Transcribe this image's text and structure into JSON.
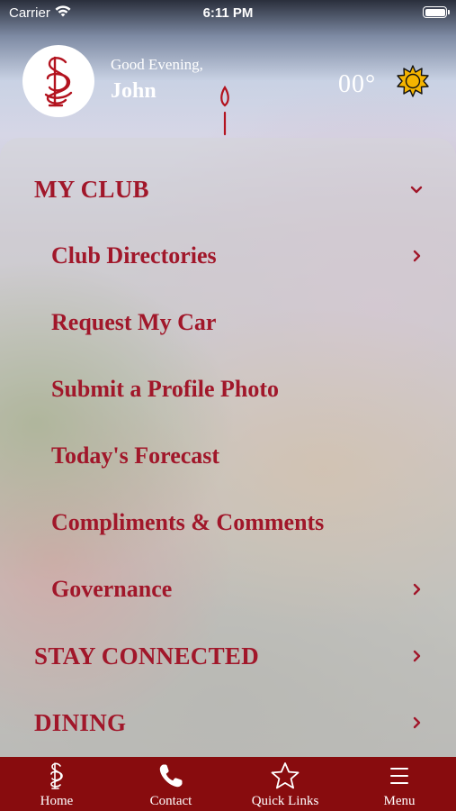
{
  "status_bar": {
    "carrier": "Carrier",
    "time": "6:11 PM"
  },
  "header": {
    "greeting": "Good Evening,",
    "user_name": "John",
    "temperature": "00°",
    "weather_icon": "sun-icon",
    "logo_icon": "club-monogram-logo"
  },
  "menu": {
    "my_club": {
      "label": "MY CLUB",
      "icon": "chevron-down-icon"
    },
    "club_directories": {
      "label": "Club Directories",
      "icon": "chevron-right-icon"
    },
    "request_car": {
      "label": "Request My Car"
    },
    "profile_photo": {
      "label": "Submit a Profile Photo"
    },
    "forecast": {
      "label": "Today's Forecast"
    },
    "compliments": {
      "label": "Compliments & Comments"
    },
    "governance": {
      "label": "Governance",
      "icon": "chevron-right-icon"
    },
    "stay_connected": {
      "label": "STAY CONNECTED",
      "icon": "chevron-right-icon"
    },
    "dining": {
      "label": "DINING",
      "icon": "chevron-right-icon"
    }
  },
  "tab_bar": {
    "home": {
      "label": "Home",
      "icon": "club-monogram-icon"
    },
    "contact": {
      "label": "Contact",
      "icon": "phone-icon"
    },
    "quick_links": {
      "label": "Quick Links",
      "icon": "star-icon"
    },
    "menu": {
      "label": "Menu",
      "icon": "hamburger-icon"
    }
  },
  "colors": {
    "accent": "#a1172a",
    "tab_bar_bg": "#880c0e",
    "text_light": "#ffffff",
    "sun": "#f5b400"
  }
}
